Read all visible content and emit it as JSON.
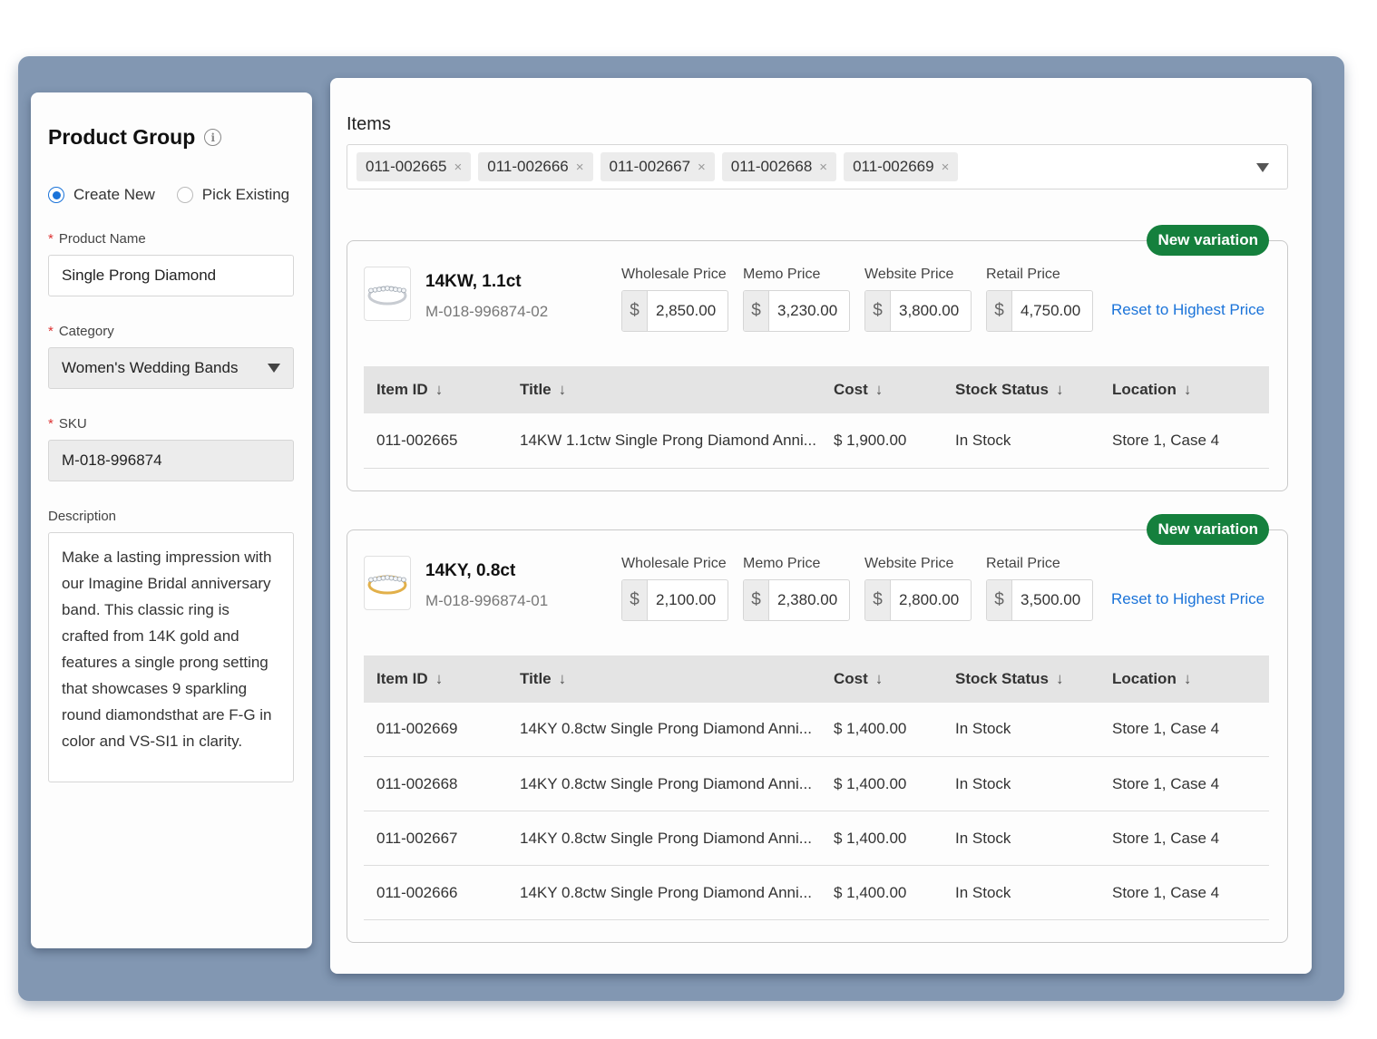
{
  "product_group": {
    "title": "Product Group",
    "radio_create": "Create New",
    "radio_pick": "Pick Existing",
    "selected": "create",
    "name_label": "Product Name",
    "name_value": "Single Prong Diamond",
    "category_label": "Category",
    "category_value": "Women's Wedding Bands",
    "sku_label": "SKU",
    "sku_value": "M-018-996874",
    "description_label": "Description",
    "description_value": "Make a lasting impression with our Imagine Bridal anniversary band. This classic ring is crafted from 14K gold and features a single prong setting that showcases 9 sparkling round diamondsthat are F-G in color and VS-SI1 in clarity."
  },
  "items": {
    "label": "Items",
    "tags": [
      "011-002665",
      "011-002666",
      "011-002667",
      "011-002668",
      "011-002669"
    ],
    "tag_remove": "×"
  },
  "price_labels": {
    "wholesale": "Wholesale Price",
    "memo": "Memo Price",
    "website": "Website Price",
    "retail": "Retail Price",
    "currency": "$"
  },
  "table_headers": {
    "item_id": "Item ID",
    "title": "Title",
    "cost": "Cost",
    "stock": "Stock Status",
    "location": "Location",
    "sort_arrow": "↓"
  },
  "variations": [
    {
      "badge": "New variation",
      "name": "14KW, 1.1ct",
      "sku": "M-018-996874-02",
      "metal_color": "#c8ccd2",
      "wholesale": "2,850.00",
      "memo": "3,230.00",
      "website": "3,800.00",
      "retail": "4,750.00",
      "reset": "Reset to Highest Price",
      "rows": [
        {
          "id": "011-002665",
          "title": "14KW 1.1ctw Single Prong Diamond Anni...",
          "cost": "$ 1,900.00",
          "stock": "In Stock",
          "location": "Store 1, Case 4"
        }
      ]
    },
    {
      "badge": "New variation",
      "name": "14KY, 0.8ct",
      "sku": "M-018-996874-01",
      "metal_color": "#e2b04a",
      "wholesale": "2,100.00",
      "memo": "2,380.00",
      "website": "2,800.00",
      "retail": "3,500.00",
      "reset": "Reset to Highest Price",
      "rows": [
        {
          "id": "011-002669",
          "title": "14KY 0.8ctw Single Prong Diamond Anni...",
          "cost": "$ 1,400.00",
          "stock": "In Stock",
          "location": "Store 1, Case 4"
        },
        {
          "id": "011-002668",
          "title": "14KY 0.8ctw Single Prong Diamond Anni...",
          "cost": "$ 1,400.00",
          "stock": "In Stock",
          "location": "Store 1, Case 4"
        },
        {
          "id": "011-002667",
          "title": "14KY 0.8ctw Single Prong Diamond Anni...",
          "cost": "$ 1,400.00",
          "stock": "In Stock",
          "location": "Store 1, Case 4"
        },
        {
          "id": "011-002666",
          "title": "14KY 0.8ctw Single Prong Diamond Anni...",
          "cost": "$ 1,400.00",
          "stock": "In Stock",
          "location": "Store 1, Case 4"
        }
      ]
    }
  ]
}
